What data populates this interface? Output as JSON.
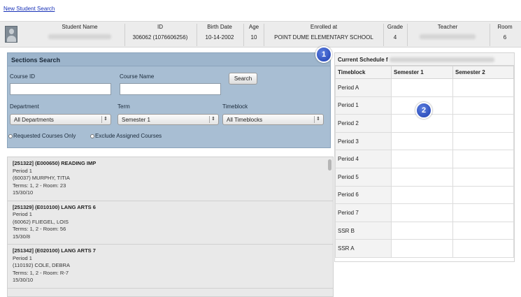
{
  "top_link": "New Student Search",
  "student": {
    "headers": {
      "name": "Student Name",
      "id": "ID",
      "birth_date": "Birth Date",
      "age": "Age",
      "enrolled_at": "Enrolled at",
      "grade": "Grade",
      "teacher": "Teacher",
      "room": "Room"
    },
    "values": {
      "id": "306062 (1076606256)",
      "birth_date": "10-14-2002",
      "age": "10",
      "enrolled_at": "POINT DUME ELEMENTARY SCHOOL",
      "grade": "4",
      "room": "6"
    }
  },
  "sections_search": {
    "title": "Sections Search",
    "course_id_label": "Course ID",
    "course_id_value": "",
    "course_name_label": "Course Name",
    "course_name_value": "",
    "search_button": "Search",
    "department_label": "Department",
    "department_value": "All Departments",
    "term_label": "Term",
    "term_value": "Semester 1",
    "timeblock_label": "Timeblock",
    "timeblock_value": "All Timeblocks",
    "requested_only": "Requested Courses Only",
    "exclude_assigned": "Exclude Assigned Courses"
  },
  "results": [
    {
      "title": "[251322] (E000650) READING IMP",
      "period": "Period 1",
      "teacher": "(60037) MURPHY, TITIA",
      "terms": "Terms: 1, 2 - Room: 23",
      "date": "15/30/10"
    },
    {
      "title": "[251329] (E010100) LANG ARTS 6",
      "period": "Period 1",
      "teacher": "(60062) FLIEGEL, LOIS",
      "terms": "Terms: 1, 2 - Room: 56",
      "date": "15/30/8"
    },
    {
      "title": "[251342] (E020100) LANG ARTS 7",
      "period": "Period 1",
      "teacher": "(110192) COLE, DEBRA",
      "terms": "Terms: 1, 2 - Room: R-7",
      "date": "15/30/10"
    }
  ],
  "schedule": {
    "title": "Current Schedule f",
    "columns": [
      "Timeblock",
      "Semester 1",
      "Semester 2"
    ],
    "rows": [
      "Period A",
      "Period 1",
      "Period 2",
      "Period 3",
      "Period 4",
      "Period 5",
      "Period 6",
      "Period 7",
      "SSR B",
      "SSR A"
    ]
  },
  "callouts": [
    "1",
    "2"
  ],
  "colors": {
    "panel_bg": "#a8bed3",
    "callout": "#2a4cc0",
    "link": "#1a33b8"
  },
  "icons": {
    "avatar": "student-avatar-icon",
    "select_arrow": "updown-arrow-icon"
  }
}
